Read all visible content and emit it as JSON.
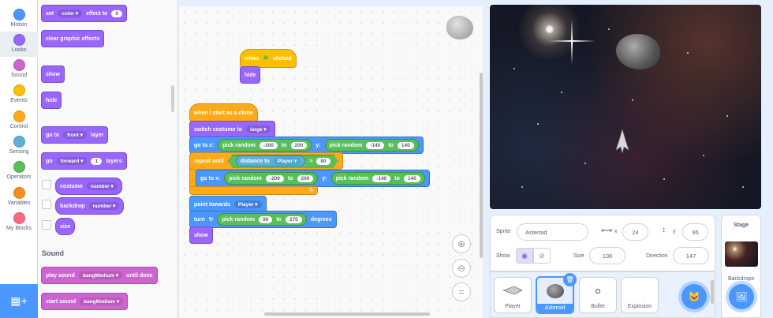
{
  "categories": [
    {
      "label": "Motion",
      "color": "#4c97ff"
    },
    {
      "label": "Looks",
      "color": "#9966ff"
    },
    {
      "label": "Sound",
      "color": "#cf63cf"
    },
    {
      "label": "Events",
      "color": "#ffbf00"
    },
    {
      "label": "Control",
      "color": "#ffab19"
    },
    {
      "label": "Sensing",
      "color": "#5cb1d6"
    },
    {
      "label": "Operators",
      "color": "#59c059"
    },
    {
      "label": "Variables",
      "color": "#ff8c1a"
    },
    {
      "label": "My Blocks",
      "color": "#ff6680"
    }
  ],
  "palette": {
    "set_effect": {
      "set": "set",
      "effect": "color",
      "to": "effect to",
      "value": "0"
    },
    "clear_effects": "clear graphic effects",
    "show": "show",
    "hide": "hide",
    "go_to_layer": {
      "go_to": "go to",
      "front": "front",
      "layer": "layer"
    },
    "go_layers": {
      "go": "go",
      "dir": "forward",
      "num": "1",
      "layers": "layers"
    },
    "costume_reporter": {
      "label": "costume",
      "dd": "number"
    },
    "backdrop_reporter": {
      "label": "backdrop",
      "dd": "number"
    },
    "size_reporter": "size",
    "sound_header": "Sound",
    "play_sound_until": {
      "play": "play sound",
      "sound": "bangMedium",
      "until": "until done"
    },
    "start_sound": {
      "start": "start sound",
      "sound": "bangMedium"
    }
  },
  "script": {
    "when_flag": {
      "when": "when",
      "clicked": "clicked"
    },
    "hide": "hide",
    "clone_hat": "when I start as a clone",
    "switch_costume": {
      "label": "switch costume to",
      "dd": "large"
    },
    "goto1": {
      "go": "go to x:",
      "pick1": "pick random",
      "a": "-200",
      "to1": "to",
      "b": "200",
      "y": "y:",
      "pick2": "pick random",
      "c": "-140",
      "to2": "to",
      "d": "140"
    },
    "repeat_until": {
      "label": "repeat until",
      "distance": "distance to",
      "target": "Player",
      "gt": ">",
      "value": "80"
    },
    "goto2": {
      "go": "go to x:",
      "pick1": "pick random",
      "a": "-200",
      "to1": "to",
      "b": "200",
      "y": "y:",
      "pick2": "pick random",
      "c": "-140",
      "to2": "to",
      "d": "140"
    },
    "point_towards": {
      "label": "point towards",
      "dd": "Player"
    },
    "turn": {
      "turn": "turn",
      "pick": "pick random",
      "a": "90",
      "to": "to",
      "b": "270",
      "degrees": "degrees"
    },
    "show": "show"
  },
  "sprite_info": {
    "sprite_label": "Sprite",
    "sprite_name": "Asteroid",
    "x_label": "x",
    "x_value": "24",
    "y_label": "y",
    "y_value": "95",
    "show_label": "Show",
    "size_label": "Size",
    "size_value": "100",
    "direction_label": "Direction",
    "direction_value": "147"
  },
  "sprites": [
    {
      "name": "Player",
      "selected": false
    },
    {
      "name": "Asteroid",
      "selected": true
    },
    {
      "name": "Bullet",
      "selected": false
    },
    {
      "name": "Explosion",
      "selected": false
    }
  ],
  "stage_panel": {
    "title": "Stage",
    "backdrops_label": "Backdrops"
  },
  "icons": {
    "extension": "extension-icon",
    "flag": "green-flag-icon",
    "zoom_in": "zoom-in-icon",
    "zoom_out": "zoom-out-icon",
    "zoom_reset": "zoom-reset-icon",
    "delete": "trash-icon",
    "add_sprite": "add-sprite-icon",
    "add_backdrop": "add-backdrop-icon"
  }
}
